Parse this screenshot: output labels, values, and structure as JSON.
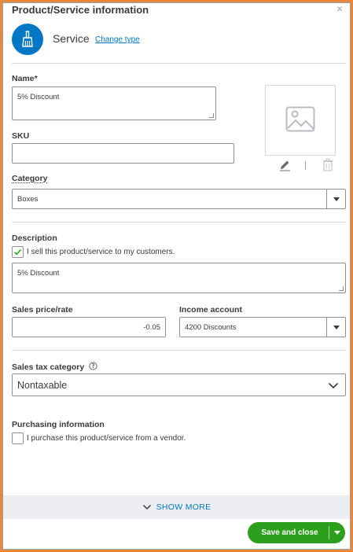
{
  "panel": {
    "title": "Product/Service information",
    "close": "×"
  },
  "type": {
    "label": "Service",
    "change_link": "Change type",
    "icon": "broom-icon",
    "color": "#0077c5"
  },
  "name": {
    "label": "Name*",
    "value": "5% Discount"
  },
  "sku": {
    "label": "SKU",
    "value": ""
  },
  "image": {
    "icon": "image-placeholder-icon",
    "actions": [
      "pencil-icon",
      "trash-icon"
    ]
  },
  "category": {
    "label": "Category",
    "value": "Boxes"
  },
  "description": {
    "label": "Description",
    "sell_checked": true,
    "sell_text": "I sell this product/service to my customers.",
    "value": "5% Discount"
  },
  "sales_price": {
    "label": "Sales price/rate",
    "value": "-0.05"
  },
  "income_account": {
    "label": "Income account",
    "value": "4200 Discounts"
  },
  "sales_tax": {
    "label": "Sales tax category",
    "value": "Nontaxable"
  },
  "purchasing": {
    "label": "Purchasing information",
    "purchase_checked": false,
    "purchase_text": "I purchase this product/service from a vendor."
  },
  "footer": {
    "show_more": "SHOW MORE",
    "save_label": "Save and close",
    "accent": "#2ca01c",
    "frame_color": "#e8863b"
  }
}
